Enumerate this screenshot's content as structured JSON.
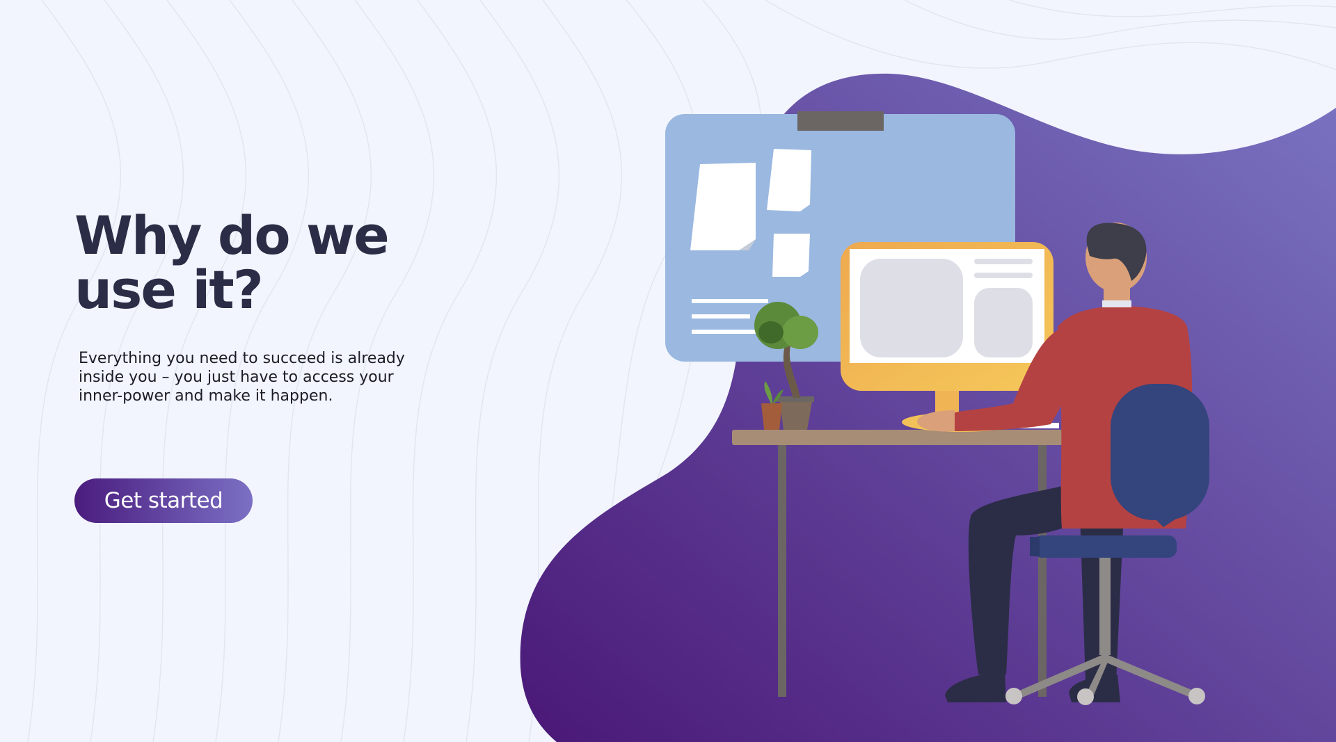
{
  "hero": {
    "title": "Why do we\nuse it?",
    "description": "Everything you need to succeed is already inside you – you just have to access your inner-power and make it happen.",
    "cta_label": "Get started"
  },
  "colors": {
    "background": "#f2f5fd",
    "title": "#2b2d46",
    "gradient_start": "#4a1c7e",
    "gradient_end": "#7b70c4",
    "board": "#9ab8e0",
    "monitor_frame": "#f0b455",
    "shirt": "#b54242",
    "chair": "#34447d"
  },
  "illustration": {
    "icon": "person-at-computer-illustration"
  }
}
